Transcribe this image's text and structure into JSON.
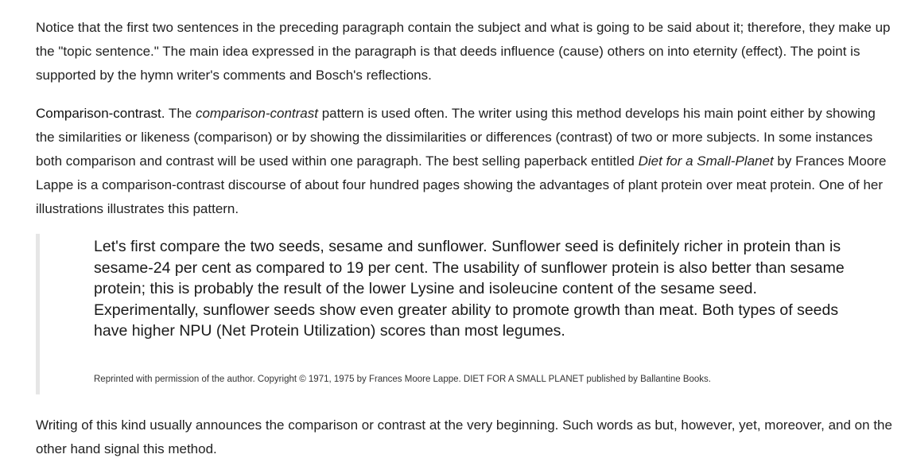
{
  "article": {
    "paragraph1": "Notice that the first two sentences in the preceding paragraph contain the subject and what is going to be said about it; therefore, they make up the \"topic sentence.\" The main idea expressed in the paragraph is that deeds influence (cause) others on into eternity (effect). The point is supported by the hymn writer's comments and Bosch's reflections.",
    "paragraph2": {
      "heading": "Comparison-contrast.",
      "text_a": " The ",
      "italic_a": "comparison-contrast",
      "text_b": " pattern is used often. The writer using this method develops his main point either by showing the similarities or likeness (comparison) or by showing the dissimilarities or differences (contrast) of two or more subjects. In some instances both comparison and contrast will be used within one paragraph. The best selling paperback entitled ",
      "italic_b": "Diet for a Small-Planet",
      "text_c": " by Frances Moore Lappe is a comparison-contrast discourse of about four hundred pages showing the advantages of plant protein over meat protein. One of her illustrations illustrates this pattern."
    },
    "blockquote": {
      "text": "Let's first compare the two seeds, sesame and sunflower. Sunflower seed is definitely richer in protein than is sesame-24 per cent as compared to 19 per cent. The usability of sunflower protein is also better than sesame protein; this is probably the result of the lower Lysine and isoleucine content of the sesame seed. Experimentally, sunflower seeds show even greater ability to promote growth than meat. Both types of seeds have higher NPU (Net Protein Utilization) scores than most legumes.",
      "credit": "Reprinted with permission of the author. Copyright © 1971, 1975 by Frances Moore Lappe. DIET FOR A SMALL PLANET published by Ballantine Books."
    },
    "paragraph3": "Writing of this kind usually announces the comparison or contrast at the very beginning. Such words as but, however, yet, moreover, and on the other hand signal this method."
  }
}
